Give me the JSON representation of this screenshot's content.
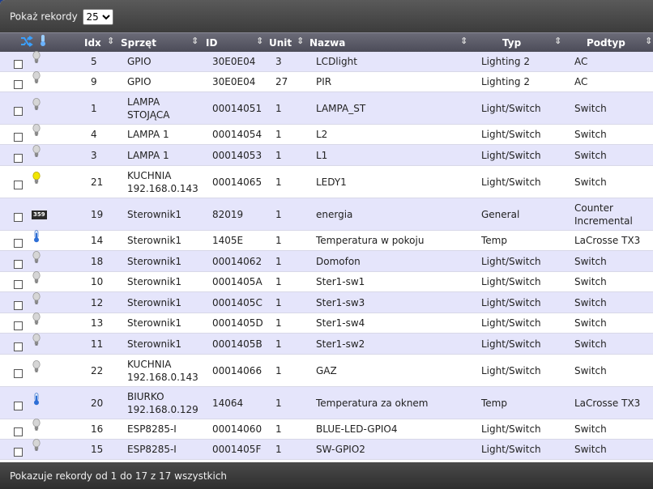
{
  "toolbar": {
    "show_label": "Pokaż rekordy",
    "page_size": "25",
    "page_size_options": [
      "25"
    ]
  },
  "columns": {
    "idx": "Idx",
    "hardware": "Sprzęt",
    "id": "ID",
    "unit": "Unit",
    "name": "Nazwa",
    "type": "Typ",
    "subtype": "Podtyp"
  },
  "rows": [
    {
      "icon": "bulb-off",
      "idx": "5",
      "hw": [
        "GPIO"
      ],
      "id": "30E0E04",
      "unit": "3",
      "name": "LCDlight",
      "type": "Lighting 2",
      "subtype": [
        "AC"
      ]
    },
    {
      "icon": "bulb-off",
      "idx": "9",
      "hw": [
        "GPIO"
      ],
      "id": "30E0E04",
      "unit": "27",
      "name": "PIR",
      "type": "Lighting 2",
      "subtype": [
        "AC"
      ]
    },
    {
      "icon": "bulb-off",
      "idx": "1",
      "hw": [
        "LAMPA",
        "STOJĄCA"
      ],
      "id": "00014051",
      "unit": "1",
      "name": "LAMPA_ST",
      "type": "Light/Switch",
      "subtype": [
        "Switch"
      ]
    },
    {
      "icon": "bulb-off",
      "idx": "4",
      "hw": [
        "LAMPA 1"
      ],
      "id": "00014054",
      "unit": "1",
      "name": "L2",
      "type": "Light/Switch",
      "subtype": [
        "Switch"
      ]
    },
    {
      "icon": "bulb-off",
      "idx": "3",
      "hw": [
        "LAMPA 1"
      ],
      "id": "00014053",
      "unit": "1",
      "name": "L1",
      "type": "Light/Switch",
      "subtype": [
        "Switch"
      ]
    },
    {
      "icon": "bulb-on",
      "idx": "21",
      "hw": [
        "KUCHNIA",
        "192.168.0.143"
      ],
      "id": "00014065",
      "unit": "1",
      "name": "LEDY1",
      "type": "Light/Switch",
      "subtype": [
        "Switch"
      ]
    },
    {
      "icon": "counter",
      "icon_text": "359",
      "idx": "19",
      "hw": [
        "Sterownik1"
      ],
      "id": "82019",
      "unit": "1",
      "name": "energia",
      "type": "General",
      "subtype": [
        "Counter",
        "Incremental"
      ]
    },
    {
      "icon": "thermometer",
      "idx": "14",
      "hw": [
        "Sterownik1"
      ],
      "id": "1405E",
      "unit": "1",
      "name": "Temperatura w pokoju",
      "type": "Temp",
      "subtype": [
        "LaCrosse TX3"
      ]
    },
    {
      "icon": "bulb-off",
      "idx": "18",
      "hw": [
        "Sterownik1"
      ],
      "id": "00014062",
      "unit": "1",
      "name": "Domofon",
      "type": "Light/Switch",
      "subtype": [
        "Switch"
      ]
    },
    {
      "icon": "bulb-off",
      "idx": "10",
      "hw": [
        "Sterownik1"
      ],
      "id": "0001405A",
      "unit": "1",
      "name": "Ster1-sw1",
      "type": "Light/Switch",
      "subtype": [
        "Switch"
      ]
    },
    {
      "icon": "bulb-off",
      "idx": "12",
      "hw": [
        "Sterownik1"
      ],
      "id": "0001405C",
      "unit": "1",
      "name": "Ster1-sw3",
      "type": "Light/Switch",
      "subtype": [
        "Switch"
      ]
    },
    {
      "icon": "bulb-off",
      "idx": "13",
      "hw": [
        "Sterownik1"
      ],
      "id": "0001405D",
      "unit": "1",
      "name": "Ster1-sw4",
      "type": "Light/Switch",
      "subtype": [
        "Switch"
      ]
    },
    {
      "icon": "bulb-off",
      "idx": "11",
      "hw": [
        "Sterownik1"
      ],
      "id": "0001405B",
      "unit": "1",
      "name": "Ster1-sw2",
      "type": "Light/Switch",
      "subtype": [
        "Switch"
      ]
    },
    {
      "icon": "bulb-off",
      "idx": "22",
      "hw": [
        "KUCHNIA",
        "192.168.0.143"
      ],
      "id": "00014066",
      "unit": "1",
      "name": "GAZ",
      "type": "Light/Switch",
      "subtype": [
        "Switch"
      ]
    },
    {
      "icon": "thermometer",
      "idx": "20",
      "hw": [
        "BIURKO",
        "192.168.0.129"
      ],
      "id": "14064",
      "unit": "1",
      "name": "Temperatura za oknem",
      "type": "Temp",
      "subtype": [
        "LaCrosse TX3"
      ]
    },
    {
      "icon": "bulb-off",
      "idx": "16",
      "hw": [
        "ESP8285-I"
      ],
      "id": "00014060",
      "unit": "1",
      "name": "BLUE-LED-GPIO4",
      "type": "Light/Switch",
      "subtype": [
        "Switch"
      ]
    },
    {
      "icon": "bulb-off",
      "idx": "15",
      "hw": [
        "ESP8285-I"
      ],
      "id": "0001405F",
      "unit": "1",
      "name": "SW-GPIO2",
      "type": "Light/Switch",
      "subtype": [
        "Switch"
      ]
    }
  ],
  "footer": {
    "info": "Pokazuje rekordy od 1 do 17 z 17 wszystkich"
  },
  "colors": {
    "row_odd": "#e5e5fb",
    "row_even": "#ffffff",
    "header": "#55555f",
    "bulb_on": "#f2e600"
  }
}
